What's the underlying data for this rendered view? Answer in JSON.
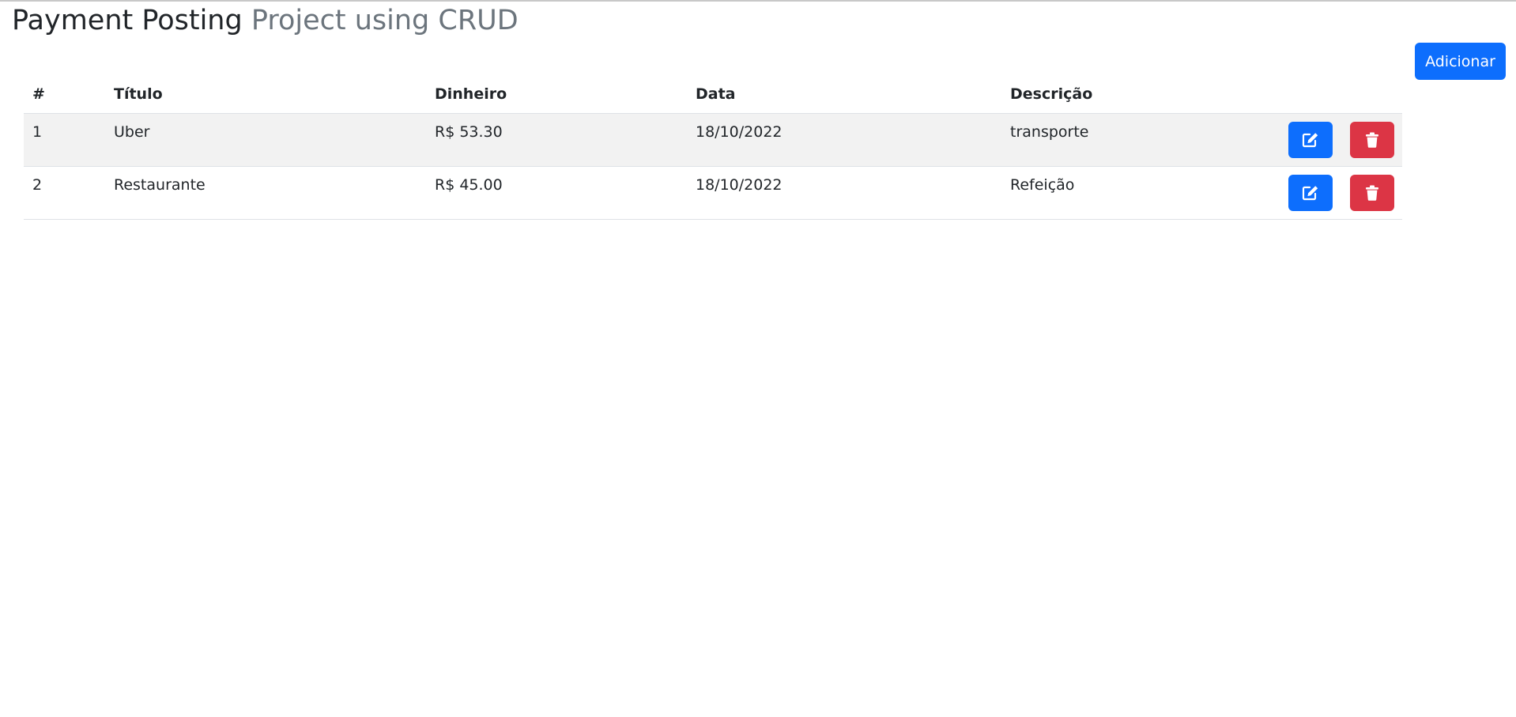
{
  "header": {
    "title_main": "Payment Posting",
    "title_sub": "Project using CRUD"
  },
  "toolbar": {
    "add_label": "Adicionar"
  },
  "table": {
    "columns": [
      "#",
      "Título",
      "Dinheiro",
      "Data",
      "Descrição",
      ""
    ],
    "rows": [
      {
        "id": "1",
        "titulo": "Uber",
        "dinheiro": "R$ 53.30",
        "data": "18/10/2022",
        "descricao": "transporte"
      },
      {
        "id": "2",
        "titulo": "Restaurante",
        "dinheiro": "R$ 45.00",
        "data": "18/10/2022",
        "descricao": "Refeição"
      }
    ]
  },
  "icons": {
    "edit": "edit-icon",
    "delete": "trash-icon"
  },
  "colors": {
    "primary": "#0d6efd",
    "danger": "#dc3545",
    "muted": "#6c757d",
    "striped_row": "#f2f2f2"
  }
}
